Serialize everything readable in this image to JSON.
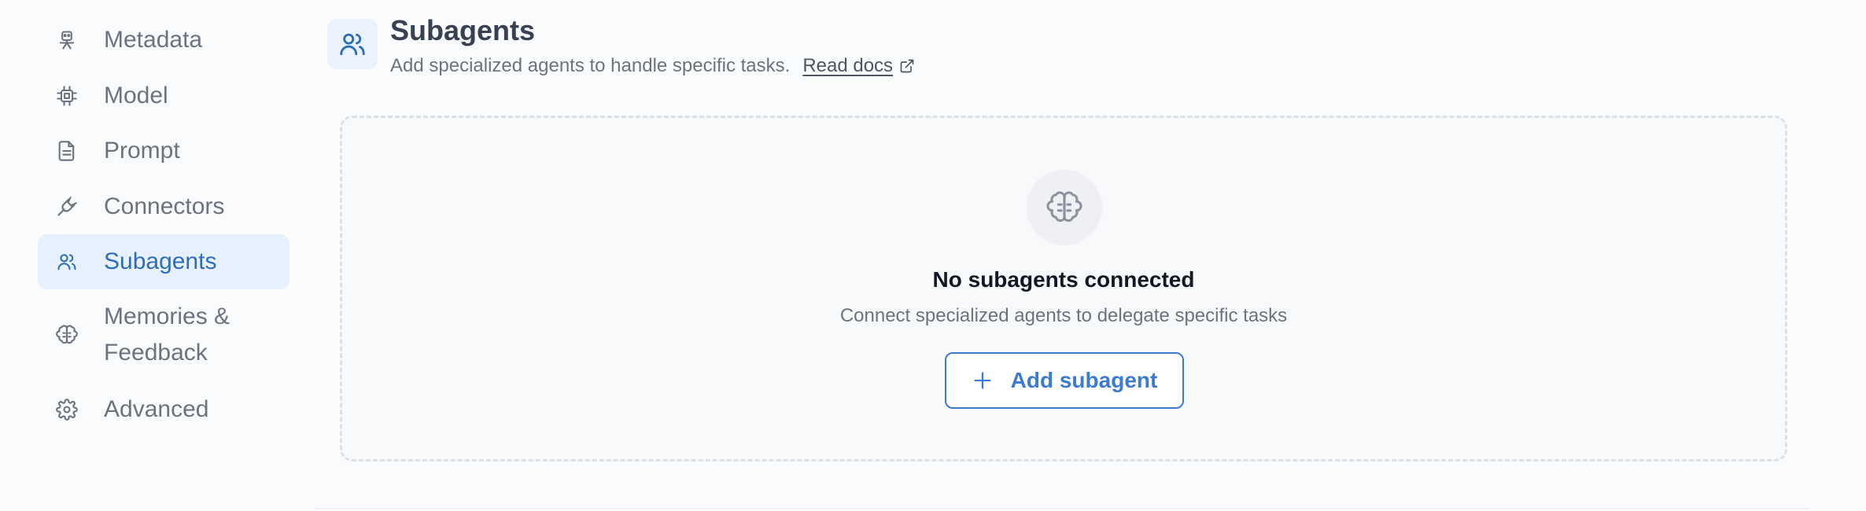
{
  "sidebar": {
    "items": [
      {
        "label": "Metadata",
        "icon": "metadata-icon",
        "active": false
      },
      {
        "label": "Model",
        "icon": "cpu-chip-icon",
        "active": false
      },
      {
        "label": "Prompt",
        "icon": "document-icon",
        "active": false
      },
      {
        "label": "Connectors",
        "icon": "plug-icon",
        "active": false
      },
      {
        "label": "Subagents",
        "icon": "users-icon",
        "active": true
      },
      {
        "label_line1": "Memories &",
        "label_line2": "Feedback",
        "icon": "brain-icon",
        "active": false
      },
      {
        "label": "Advanced",
        "icon": "gear-icon",
        "active": false
      }
    ]
  },
  "header": {
    "title": "Subagents",
    "subtitle": "Add specialized agents to handle specific tasks.",
    "docs_link": "Read docs",
    "icon": "users-icon"
  },
  "empty_state": {
    "icon": "brain-icon",
    "title": "No subagents connected",
    "description": "Connect specialized agents to delegate specific tasks",
    "button_label": "Add subagent",
    "button_icon": "plus-icon"
  },
  "colors": {
    "accent": "#3b7bd1",
    "active_bg": "#e7f1fd",
    "muted_text": "#6b7280"
  }
}
